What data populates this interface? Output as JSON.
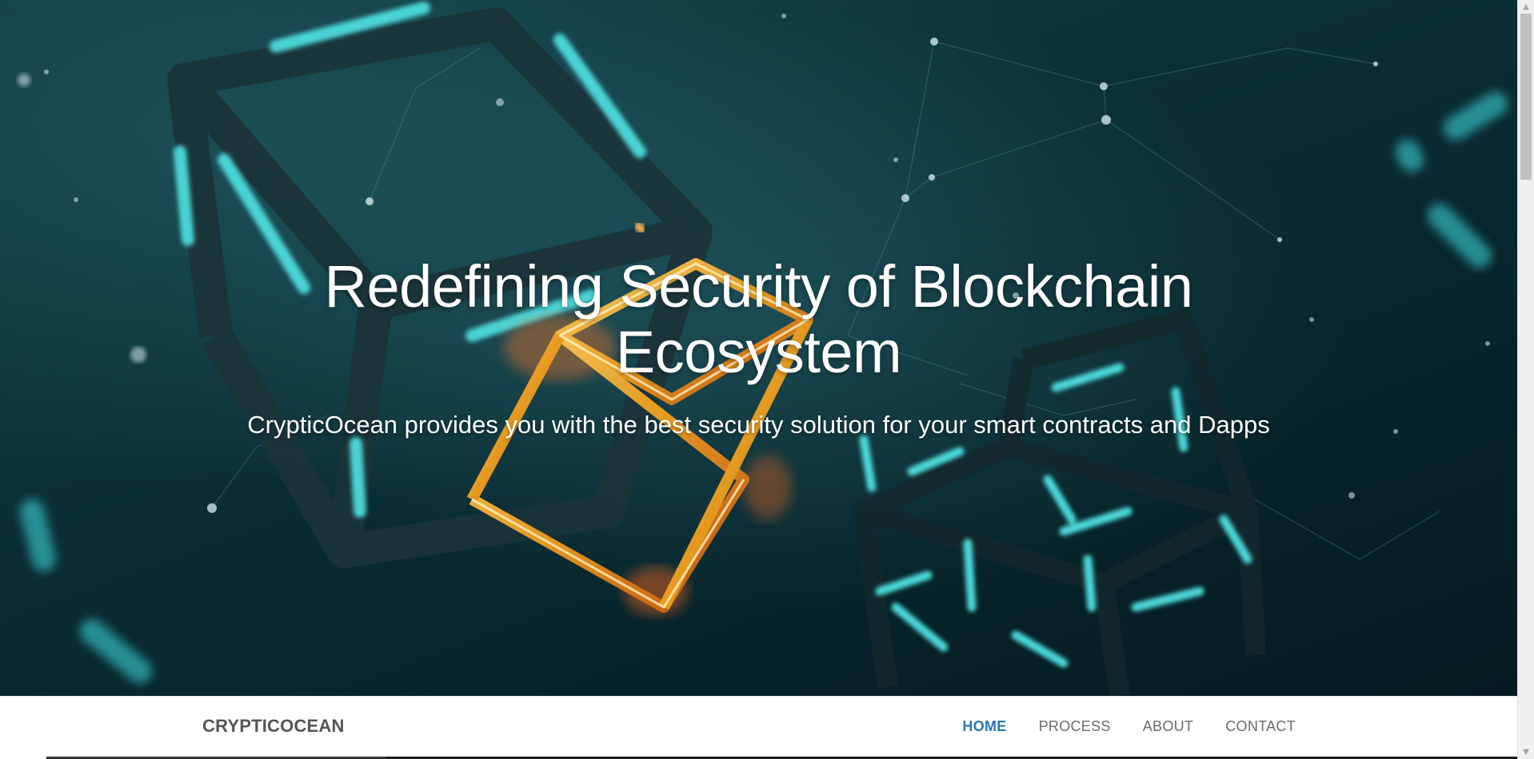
{
  "hero": {
    "title": "Redefining Security of Blockchain Ecosystem",
    "subtitle": "CrypticOcean provides you with the best security solution for your smart contracts and Dapps",
    "background_icon": "blockchain-cubes-image"
  },
  "navbar": {
    "brand": "CRYPTICOCEAN",
    "links": [
      {
        "label": "HOME",
        "active": true
      },
      {
        "label": "PROCESS",
        "active": false
      },
      {
        "label": "ABOUT",
        "active": false
      },
      {
        "label": "CONTACT",
        "active": false
      }
    ],
    "active_color": "#2c76b8"
  },
  "scrollbar": {
    "up_icon": "chevron-up-icon",
    "down_icon": "chevron-down-icon"
  }
}
